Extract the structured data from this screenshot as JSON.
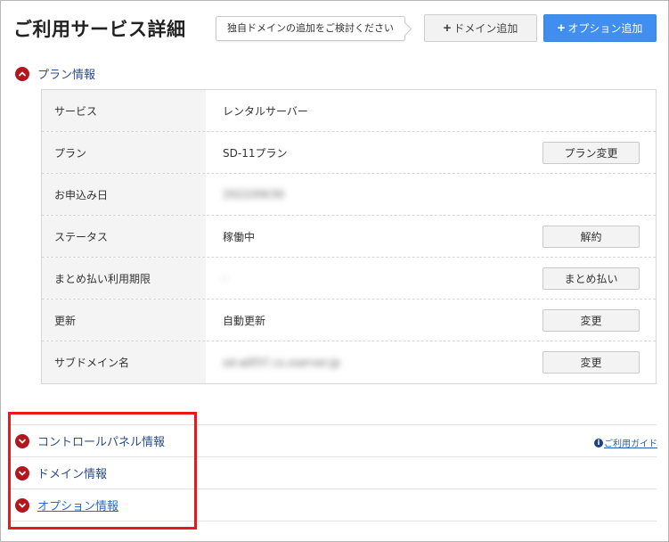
{
  "header": {
    "title": "ご利用サービス詳細",
    "tooltip": "独自ドメインの追加をご検討ください",
    "add_domain_label": "ドメイン追加",
    "add_option_label": "オプション追加",
    "plus_glyph": "+"
  },
  "plan_section": {
    "title": "プラン情報",
    "rows": [
      {
        "label": "サービス",
        "value": "レンタルサーバー",
        "button": ""
      },
      {
        "label": "プラン",
        "value": "SD-11プラン",
        "button": "プラン変更"
      },
      {
        "label": "お申込み日",
        "value": "2022/09/30",
        "button": ""
      },
      {
        "label": "ステータス",
        "value": "稼働中",
        "button": "解約"
      },
      {
        "label": "まとめ払い利用期限",
        "value": "-",
        "button": "まとめ払い"
      },
      {
        "label": "更新",
        "value": "自動更新",
        "button": "変更"
      },
      {
        "label": "サブドメイン名",
        "value": "sd-a0f37.cs.xserver.jp",
        "button": "変更"
      }
    ]
  },
  "collapsed_sections": {
    "control_panel": "コントロールパネル情報",
    "domain": "ドメイン情報",
    "option": "オプション情報"
  },
  "guide": {
    "icon_glyph": "i",
    "label": "ご利用ガイド"
  },
  "colors": {
    "accent_blue": "#3f8ef0",
    "section_icon_red": "#b4161e",
    "highlight_red": "#e61a1a"
  }
}
